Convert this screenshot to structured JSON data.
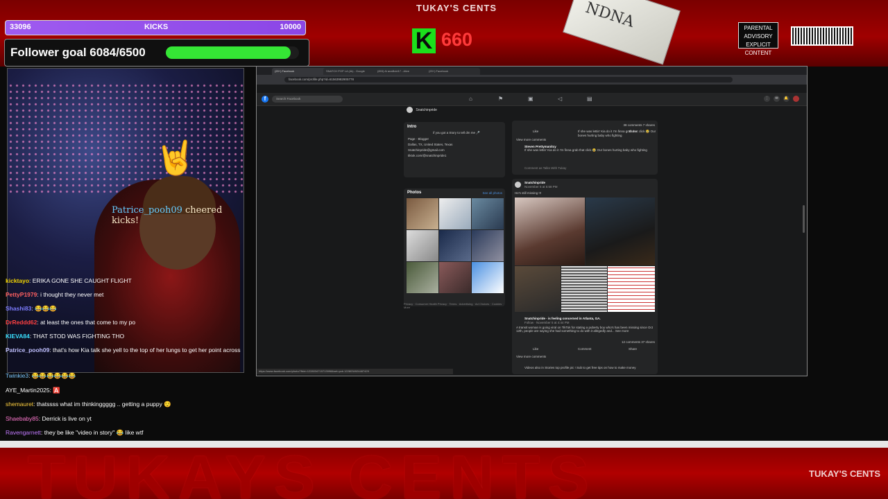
{
  "overlay": {
    "top_brand": "TUKAY'S CENTS",
    "kicks_bar": {
      "left": "33096",
      "center": "KICKS",
      "right": "10000"
    },
    "follower_goal": {
      "label": "Follower goal 6084/6500",
      "current": 6084,
      "goal": 6500
    },
    "kick_logo": "K",
    "kick_count": "660",
    "advisory_text": "PARENTAL ADVISORY EXPLICIT CONTENT",
    "bottom_big_text": "TUKAYS CENTS",
    "bottom_brand": "TUKAY'S CENTS",
    "bill_text": "NDNA"
  },
  "webcam": {
    "cheer": {
      "user": "Patrice_pooh09",
      "text": " cheered ",
      "suffix": " kicks!"
    }
  },
  "chat": [
    {
      "user": "kicktayo",
      "text": "ERIKA GONE SHE CAUGHT FLIGHT",
      "color": "#f2d500"
    },
    {
      "user": "PettyP1979",
      "text": "i thought they never met",
      "color": "#ff6060"
    },
    {
      "user": "Shashi83",
      "text": "😂😂😂",
      "color": "#7c7cff"
    },
    {
      "user": "DrReddd62",
      "text": "at least the ones that come to my po",
      "color": "#ff4040"
    },
    {
      "user": "KIEVA84",
      "text": "THAT STOD WAS FIGHTING THO",
      "color": "#3ae0ff"
    },
    {
      "user": "Patrice_pooh09",
      "text": "that's how Kia talk she yell to the top of her lungs to get her point across",
      "color": "#c0c0ff"
    }
  ],
  "chat_below": [
    {
      "user": "Twinkie3",
      "text": "😂😂😂😂😂😂",
      "color": "#7cc7ff"
    },
    {
      "user": "AYE_Martin2025",
      "text": "🅰️",
      "color": "#ffffff"
    },
    {
      "user": "shemauret",
      "text": "thatssss what im thinkinggggg .. getting a puppy 😌",
      "color": "#ffd040"
    },
    {
      "user": "Shaebaby85",
      "text": "Derrick is live on yt",
      "color": "#ff7ad0"
    },
    {
      "user": "Ravengarnett",
      "text": "they be like \"video in story\" 😂 like wtf",
      "color": "#c27aff"
    }
  ],
  "browser": {
    "tabs": [
      "(20+) Facebook",
      "SNATCH POP LA (4k) - Google",
      "(893) Al anaBold17 - Alive",
      "(20+) Facebook"
    ],
    "url": "facebook.com/profile.php?id=61563982905778",
    "search_placeholder": "Search Facebook",
    "profile_name": "Snatchinpride",
    "intro": {
      "title": "Intro",
      "bio": "if you got a Story to tell dm me 🎤",
      "lines": [
        "Page · Blogger",
        "Dallas, TX, United States, Texas",
        "Snatchinpride@gmail.com",
        "tiktok.com/@snatchinpride1"
      ]
    },
    "photos": {
      "title": "Photos",
      "see_all": "See all photos"
    },
    "footer_links": "Privacy · Consumer Health Privacy · Terms · Advertising · Ad Choices · Cookies · More",
    "post1": {
      "stats": "38 comments  7 shares",
      "like": "Like",
      "comment": "If she was lettin' Kia do it I'm finna grab that click 😂 Our bones hurting baby who fighting",
      "share": "Share",
      "view_more": "View more comments",
      "commenter": "Steven Prettymanitcy",
      "comment_as": "Comment as Talks With Tukay"
    },
    "post2": {
      "name": "Snatchinpride",
      "date": "November 5 at 5:58 PM",
      "caption": "He's still missing !!!",
      "shared_name": "Snatchinpride · is feeling concerned in Atlanta, GA.",
      "shared_date": "Follow · November 5 at 4:44 PM",
      "text": "A transit woman is going viral on TikTok for stating a puberty boy who's has been missing since Oct 12th, people are saying she had something to do with it allegedly and... See more",
      "stats": "12 comments  37 shares",
      "like": "Like",
      "comment": "Comment",
      "share": "Share",
      "view_more": "View more comments",
      "reply_text": "Videos also in Stories top profile pic ! Sub to get free tips on how to make money"
    },
    "status_url": "https://www.facebook.com/photo/?fbid=1228034715713998&set=pcb.1228034924487429"
  }
}
